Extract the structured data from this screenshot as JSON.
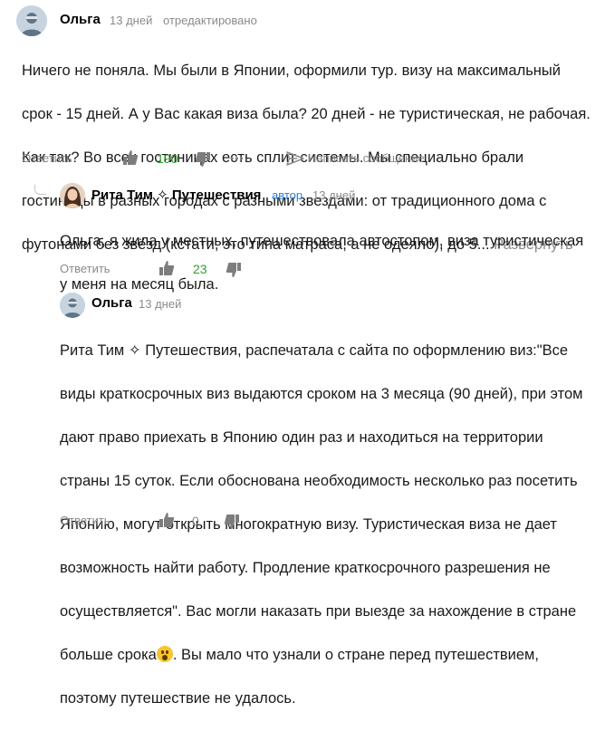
{
  "comments": [
    {
      "author": "Ольга",
      "date": "13 дней",
      "edited": "отредактировано",
      "lines": [
        "Ничего не поняла. Мы были в Японии, оформили тур. визу на максимальный",
        "срок - 15 дней. А у Вас какая виза была? 20 дней - не туристическая, не рабочая.",
        "Как так? Во всех гостиницах есть сплит системы. Мы специально брали",
        "гостиницы в разных городах с разными звездами: от традиционного дома с",
        "футонами без звёзд (кстати, это типа матраса, а не одеяло), до 5..."
      ],
      "expand": "Развернуть",
      "reply": "Ответить",
      "likes": "190",
      "more": "•••",
      "write": "Написать сообщение"
    },
    {
      "author": "Рита Тим ✧ Путешествия",
      "badge": "автор",
      "date": "13 дней",
      "lines": [
        "Ольга, я жила у местных, путешествовала автостопом, виза туристическая",
        "у меня на месяц была."
      ],
      "reply": "Ответить",
      "likes": "23"
    },
    {
      "author": "Ольга",
      "date": "13 дней",
      "lines": [
        "Рита Тим ✧ Путешествия, распечатала с сайта по оформлению виз:\"Все",
        "виды краткосрочных виз выдаются сроком на 3 месяца (90 дней), при этом",
        "дают право приехать в Японию один раз и находиться на территории",
        "страны 15 суток. Если обоснована необходимость несколько раз посетить",
        "Японию, могут открыть многократную визу. Туристическая виза не дает",
        "возможность найти работу. Продление краткосрочного разрешения не",
        "осуществляется\". Вас могли наказать при выезде за нахождение в стране",
        "больше срока",
        ". Вы мало что узнали о стране перед путешествием,",
        "поэтому путешествие не удалось."
      ],
      "reply": "Ответить",
      "likes": "0"
    }
  ],
  "icons": {
    "avatar": "user-avatar-icon",
    "like": "thumbs-up-icon",
    "dislike": "thumbs-down-icon",
    "more": "more-dots-icon",
    "write": "paper-plane-icon",
    "emoji": "astonished-face-emoji"
  },
  "colors": {
    "likes_green": "#2e9e2e",
    "author_badge_blue": "#2a7fd4",
    "muted_gray": "#8a8a8a"
  }
}
